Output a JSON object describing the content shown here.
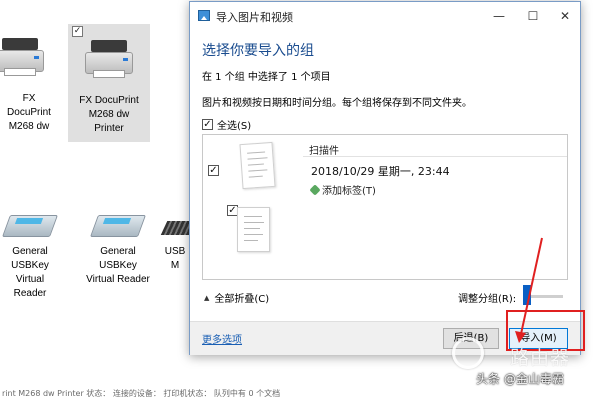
{
  "background": {
    "devices": [
      {
        "label": "FX DocuPrint\nM268 dw",
        "icon": "printer-icon"
      },
      {
        "label": "FX DocuPrint\nM268 dw\nPrinter",
        "icon": "printer-icon",
        "selected": true
      },
      {
        "label": "General\nUSBKey\nVirtual Reader",
        "icon": "usb-reader-icon"
      },
      {
        "label": "General\nUSBKey\nVirtual Reader",
        "icon": "usb-reader-icon"
      },
      {
        "label": "USB\nM",
        "icon": "keyboard-icon"
      }
    ],
    "status_text": "rint M268 dw Printer 状态：    连接的设备：    打印机状态：    队列中有 0 个文档"
  },
  "dialog": {
    "title": "导入图片和视频",
    "minimize": "—",
    "maximize": "☐",
    "close": "✕",
    "heading": "选择你要导入的组",
    "summary": "在 1 个组 中选择了 1 个项目",
    "info": "图片和视频按日期和时间分组。每个组将保存到不同文件夹。",
    "select_all_label": "全选(S)",
    "group": {
      "name": "扫描件",
      "date": "2018/10/29 星期一, 23:44",
      "add_tag": "添加标签(T)"
    },
    "collapse_all": "全部折叠(C)",
    "adjust_groups": "调整分组(R):",
    "more_options": "更多选项",
    "back_button": "后退(B)",
    "import_button": "导入(M)"
  },
  "watermark": {
    "brand": "路由器",
    "credit": "头条 @金山毒霸"
  },
  "colors": {
    "annotation": "#e02020",
    "heading": "#1a4c8f",
    "link": "#1a5fb4",
    "primary_border": "#0078d7"
  }
}
